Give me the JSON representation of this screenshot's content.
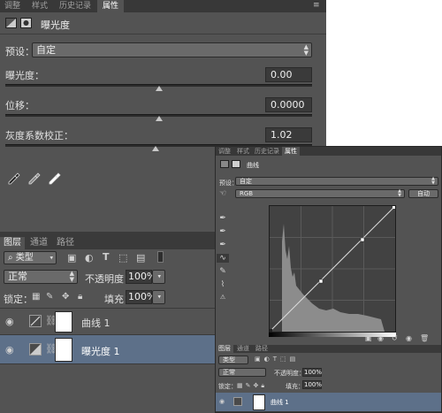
{
  "main_panel": {
    "tabs": [
      "调整",
      "样式",
      "历史记录",
      "属性"
    ],
    "active_tab": "属性",
    "menu_icon": "panel-menu-icon",
    "header_title": "曝光度",
    "preset_label": "预设：",
    "preset_value": "自定",
    "sliders": [
      {
        "label": "曝光度：",
        "value": "0.00",
        "level": 0.5
      },
      {
        "label": "位移：",
        "value": "0.0000",
        "level": 0.5
      },
      {
        "label": "灰度系数校正：",
        "value": "1.02",
        "level": 0.49
      }
    ],
    "droppers": [
      "black-eyedropper-icon",
      "gray-eyedropper-icon",
      "white-eyedropper-icon"
    ]
  },
  "layers_panel": {
    "tabs": [
      "图层",
      "通道",
      "路径"
    ],
    "active_tab": "图层",
    "filter_label": "类型",
    "blend_mode": "正常",
    "opacity_label": "不透明度：",
    "opacity_value": "100%",
    "lock_label": "锁定：",
    "fill_label": "填充：",
    "fill_value": "100%",
    "layers": [
      {
        "name": "曲线 1",
        "icon": "curves-adjustment-icon",
        "selected": false
      },
      {
        "name": "曝光度 1",
        "icon": "exposure-adjustment-icon",
        "selected": true
      }
    ]
  },
  "curves_panel": {
    "tabs": [
      "调整",
      "样式",
      "历史记录",
      "属性"
    ],
    "active_tab": "属性",
    "header_title": "曲线",
    "preset_label": "预设：",
    "preset_value": "自定",
    "channel_value": "RGB",
    "auto_button": "自动",
    "layers_tabs": [
      "图层",
      "通道",
      "路径"
    ],
    "filter_label": "类型",
    "blend_mode": "正常",
    "opacity_label": "不透明度：",
    "opacity_value": "100%",
    "lock_label": "锁定：",
    "fill_label": "填充：",
    "fill_value": "100%",
    "layer_name": "曲线 1"
  }
}
